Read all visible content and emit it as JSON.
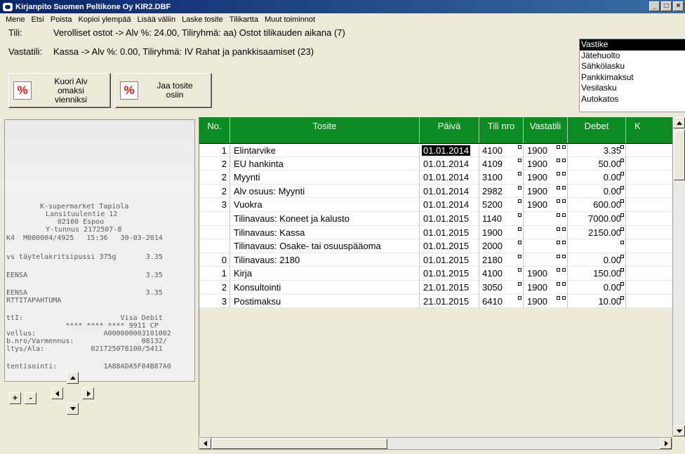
{
  "window": {
    "title": "Kirjanpito Suomen Peltikone Oy KIR2.DBF",
    "min": "_",
    "max": "□",
    "close": "×"
  },
  "menu": [
    "Mene",
    "Etsi",
    "Poista",
    "Kopioi ylempää",
    "Lisää väliin",
    "Laske tosite",
    "Tilikartta",
    "Muut toiminnot"
  ],
  "info": {
    "tili_label": "Tili:",
    "tili_value": "Verolliset ostot -> Alv %: 24.00, Tiliryhmä: aa) Ostot tilikauden aikana (7)",
    "vastatili_label": "Vastatili:",
    "vastatili_value": "Kassa -> Alv %: 0.00, Tiliryhmä: IV Rahat ja pankkisaamiset  (23)"
  },
  "buttons": {
    "kuori_alv": [
      "Kuori Alv",
      "omaksi",
      "vienniksi"
    ],
    "jaa_tosite": [
      "Jaa tosite",
      "osiin"
    ],
    "percent_icon": "%"
  },
  "listbox": [
    "Vastike",
    "Jätehuolto",
    "Sähkölasku",
    "Pankkimaksut",
    "Vesilasku",
    "Autokatos"
  ],
  "receipt": {
    "lines": [
      "K-supermarket Tapiola",
      "Lansituulentie 12",
      "02100 Espoo",
      "Y-tunnus 2172507-8",
      "K4  M000004/4925   15:36   30-03-2014",
      "vs täytelakritsipussi 375g       3.35",
      "EENSA                            3.35",
      "EENSA                            3.35",
      "RTTITAPAHTUMA",
      "ttI:                       Visa Debit",
      "              **** **** **** 9911 CP",
      "vellus:                A000000003101002",
      "b.nro/Varmennus:                08132/",
      "ltys/Ala:           021725078100/5411",
      "tentisointi:           1A88ADA5F04B87A0"
    ],
    "zoom_in": "+",
    "zoom_out": "-"
  },
  "grid": {
    "headers": [
      "No.",
      "Tosite",
      "Päivä",
      "Tili nro",
      "Vastatili",
      "Debet",
      "K"
    ],
    "rows": [
      {
        "no": "1",
        "tosite": "Elintarvike",
        "paiva": "01.01.2014",
        "tili": "4100",
        "vastatili": "1900",
        "debet": "3.35"
      },
      {
        "no": "2",
        "tosite": "EU hankinta",
        "paiva": "01.01.2014",
        "tili": "4109",
        "vastatili": "1900",
        "debet": "50.00"
      },
      {
        "no": "2",
        "tosite": "Myynti",
        "paiva": "01.01.2014",
        "tili": "3100",
        "vastatili": "1900",
        "debet": "0.00"
      },
      {
        "no": "2",
        "tosite": "Alv osuus: Myynti",
        "paiva": "01.01.2014",
        "tili": "2982",
        "vastatili": "1900",
        "debet": "0.00"
      },
      {
        "no": "3",
        "tosite": "Vuokra",
        "paiva": "01.01.2014",
        "tili": "5200",
        "vastatili": "1900",
        "debet": "600.00"
      },
      {
        "no": "",
        "tosite": "Tilinavaus: Koneet ja kalusto",
        "paiva": "01.01.2015",
        "tili": "1140",
        "vastatili": "",
        "debet": "7000.00"
      },
      {
        "no": "",
        "tosite": "Tilinavaus: Kassa",
        "paiva": "01.01.2015",
        "tili": "1900",
        "vastatili": "",
        "debet": "2150.00"
      },
      {
        "no": "",
        "tosite": "Tilinavaus: Osake- tai osuuspääoma",
        "paiva": "01.01.2015",
        "tili": "2000",
        "vastatili": "",
        "debet": ""
      },
      {
        "no": "0",
        "tosite": "Tilinavaus: 2180",
        "paiva": "01.01.2015",
        "tili": "2180",
        "vastatili": "",
        "debet": "0.00"
      },
      {
        "no": "1",
        "tosite": "Kirja",
        "paiva": "01.01.2015",
        "tili": "4100",
        "vastatili": "1900",
        "debet": "150.00"
      },
      {
        "no": "2",
        "tosite": "Konsultointi",
        "paiva": "21.01.2015",
        "tili": "3050",
        "vastatili": "1900",
        "debet": "0.00"
      },
      {
        "no": "3",
        "tosite": "Postimaksu",
        "paiva": "21.01.2015",
        "tili": "6410",
        "vastatili": "1900",
        "debet": "10.00"
      }
    ]
  },
  "colors": {
    "header_green": "#0d8a22",
    "title_blue": "#0a246a",
    "percent_red": "#e01818"
  }
}
